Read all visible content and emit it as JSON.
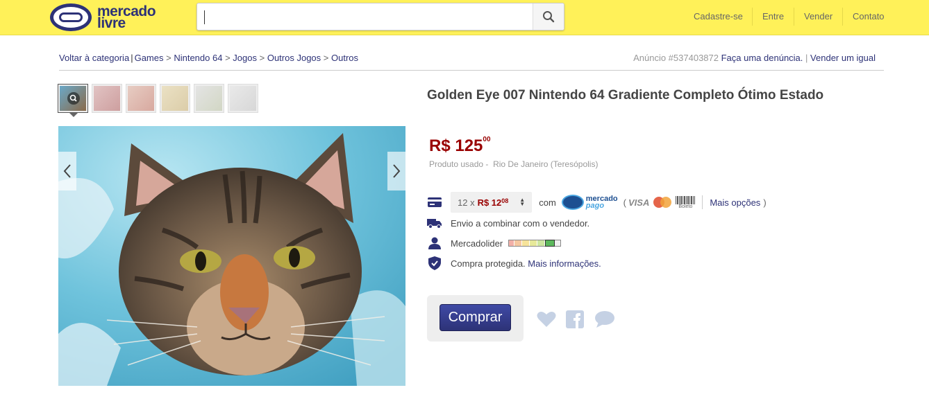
{
  "header": {
    "logo_line1": "mercado",
    "logo_line2": "livre",
    "search_placeholder": "",
    "nav": [
      "Cadastre-se",
      "Entre",
      "Vender",
      "Contato"
    ]
  },
  "breadcrumb": {
    "back": "Voltar à categoria",
    "items": [
      "Games",
      "Nintendo 64",
      "Jogos",
      "Outros Jogos",
      "Outros"
    ],
    "ad_label": "Anúncio #537403872",
    "report": "Faça uma denúncia.",
    "sell_same": "Vender um igual"
  },
  "product": {
    "title": "Golden Eye 007 Nintendo 64 Gradiente Completo Ótimo Estado",
    "price_main": "R$ 125",
    "price_cents": "00",
    "condition": "Produto usado -",
    "location": "Rio De Janeiro (Teresópolis)"
  },
  "payment": {
    "installments_prefix": "12 x",
    "installment_value": "R$ 12",
    "installment_cents": "08",
    "with_label": "com",
    "mp_line1": "mercado",
    "mp_line2": "pago",
    "paren_open": "(",
    "visa": "VISA",
    "boleto": "Boleto",
    "more_options": "Mais opções",
    "paren_close": ")"
  },
  "shipping": {
    "text": "Envio a combinar com o vendedor."
  },
  "seller": {
    "text": "Mercadolider"
  },
  "protection": {
    "text": "Compra protegida.",
    "link": "Mais informações."
  },
  "actions": {
    "buy_label": "Comprar"
  },
  "colors": {
    "header_bg": "#fff159",
    "brand_blue": "#2d3277",
    "price_red": "#990000"
  }
}
